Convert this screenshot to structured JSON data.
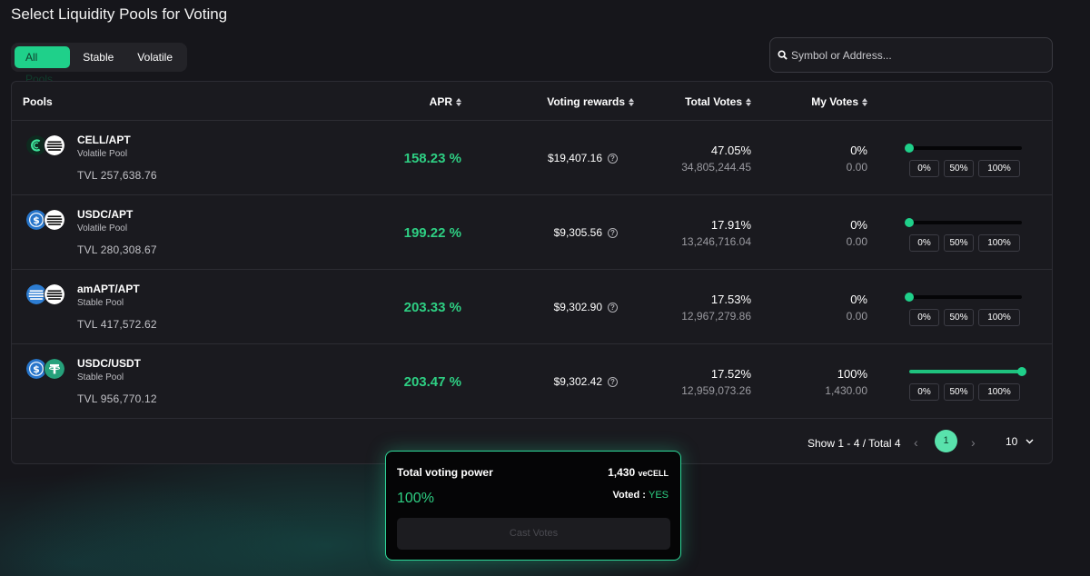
{
  "page": {
    "title": "Select Liquidity Pools for Voting"
  },
  "filters": [
    {
      "label": "All Pools",
      "active": true
    },
    {
      "label": "Stable",
      "active": false
    },
    {
      "label": "Volatile",
      "active": false
    }
  ],
  "search": {
    "placeholder": "Symbol or Address...",
    "value": ""
  },
  "table": {
    "headers": {
      "pools": "Pools",
      "apr": "APR",
      "rewards": "Voting rewards",
      "total_votes": "Total Votes",
      "my_votes": "My Votes"
    },
    "rows": [
      {
        "name": "CELL/APT",
        "type": "Volatile Pool",
        "tvl": "TVL 257,638.76",
        "apr": "158.23 %",
        "rewards": "$19,407.16",
        "votes_pct": "47.05%",
        "votes_abs": "34,805,244.45",
        "my_pct": "0%",
        "my_abs": "0.00",
        "slider_value": 0,
        "icons": [
          "cell-token-icon",
          "apt-token-icon"
        ]
      },
      {
        "name": "USDC/APT",
        "type": "Volatile Pool",
        "tvl": "TVL 280,308.67",
        "apr": "199.22 %",
        "rewards": "$9,305.56",
        "votes_pct": "17.91%",
        "votes_abs": "13,246,716.04",
        "my_pct": "0%",
        "my_abs": "0.00",
        "slider_value": 0,
        "icons": [
          "usdc-token-icon",
          "apt-token-icon"
        ]
      },
      {
        "name": "amAPT/APT",
        "type": "Stable Pool",
        "tvl": "TVL 417,572.62",
        "apr": "203.33 %",
        "rewards": "$9,302.90",
        "votes_pct": "17.53%",
        "votes_abs": "12,967,279.86",
        "my_pct": "0%",
        "my_abs": "0.00",
        "slider_value": 0,
        "icons": [
          "amapt-token-icon",
          "apt-token-icon"
        ]
      },
      {
        "name": "USDC/USDT",
        "type": "Stable Pool",
        "tvl": "TVL 956,770.12",
        "apr": "203.47 %",
        "rewards": "$9,302.42",
        "votes_pct": "17.52%",
        "votes_abs": "12,959,073.26",
        "my_pct": "100%",
        "my_abs": "1,430.00",
        "slider_value": 100,
        "icons": [
          "usdc-token-icon",
          "usdt-token-icon"
        ]
      }
    ],
    "percent_buttons": [
      "0%",
      "50%",
      "100%"
    ]
  },
  "pagination": {
    "info": "Show 1 - 4 / Total 4",
    "prev": "‹",
    "next": "›",
    "current_page": "1",
    "page_size": "10"
  },
  "vote_panel": {
    "title": "Total voting power",
    "amount": "1,430",
    "unit": "veCELL",
    "percent": "100%",
    "voted_label": "Voted :",
    "voted_value": "YES",
    "cast_button": "Cast Votes"
  },
  "colors": {
    "accent": "#1fd08a",
    "apr_green": "#2ecf83",
    "background": "#16161b",
    "panel_border": "#2fd99a"
  }
}
